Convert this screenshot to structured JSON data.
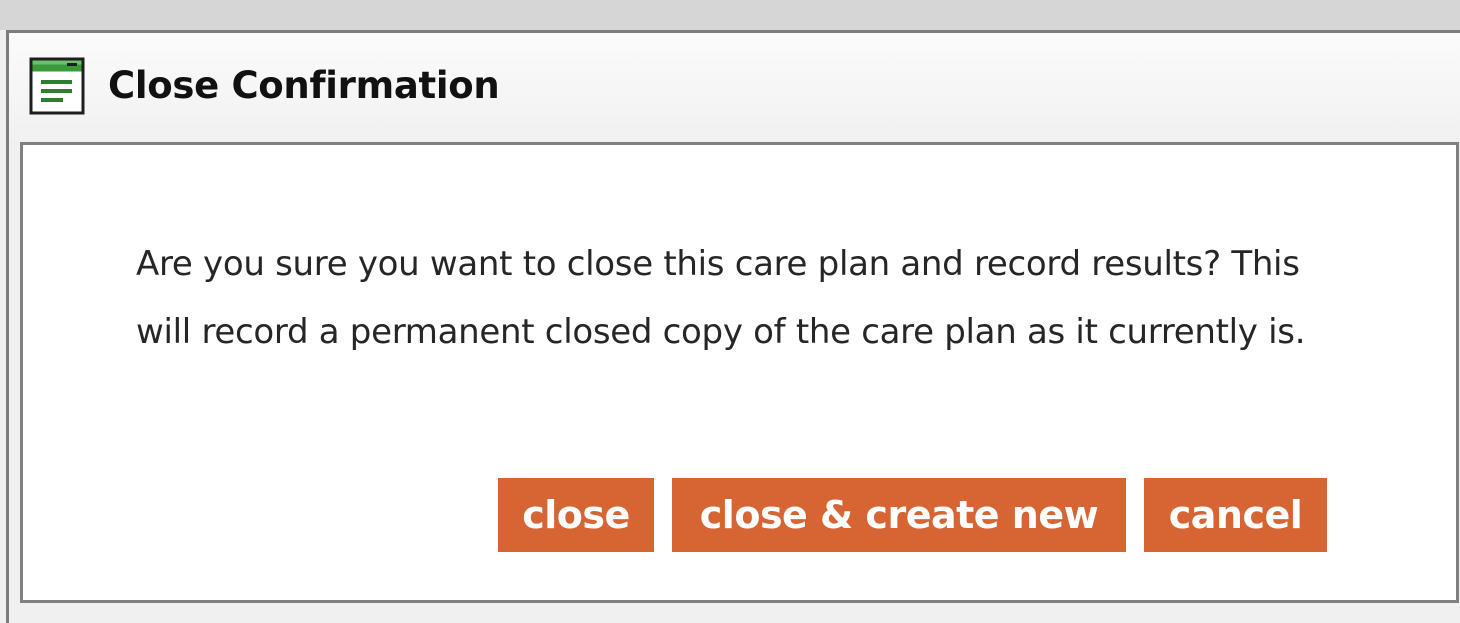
{
  "dialog": {
    "title": "Close Confirmation",
    "icon": "window-form-icon",
    "message": "Are you sure you want to close this care plan and record results? This will record a permanent closed copy of the care plan as it currently is.",
    "buttons": {
      "close_label": "close",
      "close_create_new_label": "close & create new",
      "cancel_label": "cancel"
    }
  },
  "colors": {
    "button_bg": "#d66533",
    "button_text": "#ffffff",
    "icon_green": "#2f7d2f"
  }
}
